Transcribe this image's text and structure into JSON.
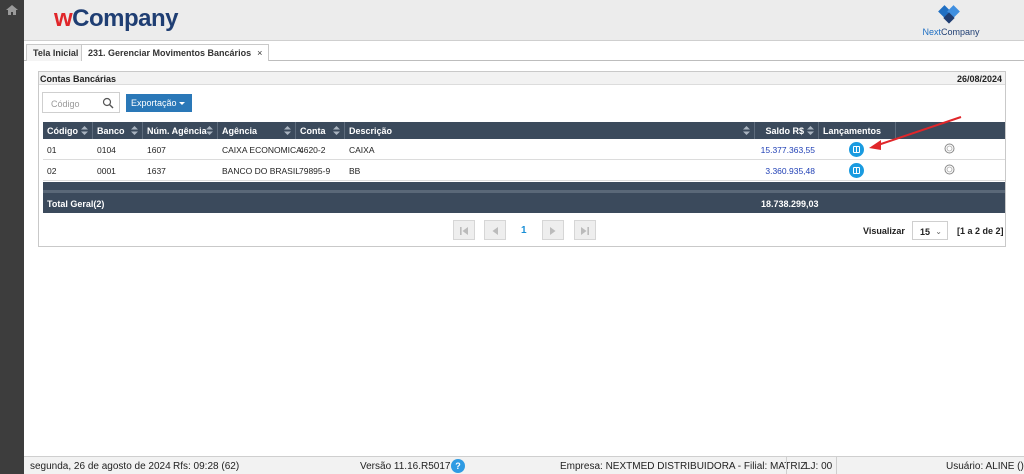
{
  "brand": {
    "w": "w",
    "company": "Company",
    "partner_prefix": "Next",
    "partner_suffix": "Company"
  },
  "tabs": [
    {
      "label": "Tela Inicial"
    },
    {
      "label": "231. Gerenciar Movimentos Bancários",
      "close": "×"
    }
  ],
  "panel": {
    "title": "Contas Bancárias",
    "date": "26/08/2024"
  },
  "search": {
    "placeholder": "Código"
  },
  "export": {
    "label": "Exportação"
  },
  "columns": [
    "Código",
    "Banco",
    "Núm. Agência",
    "Agência",
    "Conta",
    "Descrição",
    "Saldo R$",
    "Lançamentos"
  ],
  "rows": [
    {
      "codigo": "01",
      "banco": "0104",
      "num_agencia": "1607",
      "agencia": "CAIXA ECONOMICA",
      "conta": "4620-2",
      "descricao": "CAIXA",
      "saldo": "15.377.363,55"
    },
    {
      "codigo": "02",
      "banco": "0001",
      "num_agencia": "1637",
      "agencia": "BANCO DO BRASIL",
      "conta": "79895-9",
      "descricao": "BB",
      "saldo": "3.360.935,48"
    }
  ],
  "total": {
    "label": "Total Geral(2)",
    "value": "18.738.299,03"
  },
  "pagination": {
    "current_page": "1",
    "view_label": "Visualizar",
    "page_size": "15",
    "range": "[1 a 2 de 2]"
  },
  "status": {
    "date": "segunda, 26 de agosto de 2024",
    "rfs": "Rfs: 09:28 (62)",
    "version": "Versão 11.16.R5017",
    "help": "?",
    "empresa": "Empresa: NEXTMED DISTRIBUIDORA - Filial: MATRIZ",
    "lj": "LJ: 00",
    "usuario": "Usuário: ALINE ()"
  },
  "colors": {
    "header_bg": "#3b4a5c",
    "accent": "#2a78b8",
    "brand_red": "#e0262a",
    "brand_navy": "#1f3e73",
    "arrow": "#e0262a"
  }
}
